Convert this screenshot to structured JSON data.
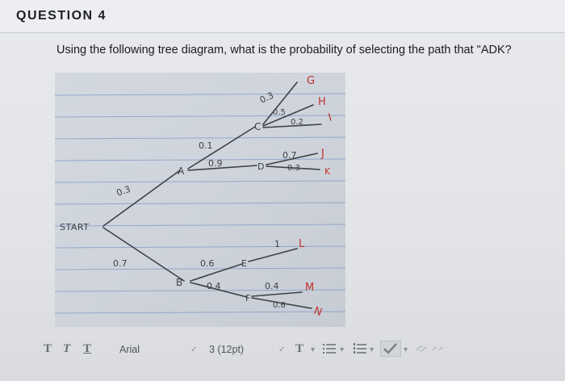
{
  "question": {
    "number": "QUESTION 4",
    "text": "Using the following tree diagram, what is the probability of selecting the path that \"ADK?"
  },
  "diagram": {
    "start": "START",
    "nodes": {
      "A": "A",
      "B": "B",
      "C": "C",
      "D": "D",
      "E": "E",
      "F": "F"
    },
    "leaves": {
      "G": "G",
      "H": "H",
      "I": "I",
      "J": "J",
      "K": "K",
      "L": "L",
      "M": "M",
      "N": "N"
    },
    "probabilities": {
      "start_A": "0.3",
      "start_B": "0.7",
      "A_C": "0.1",
      "A_D": "0.9",
      "B_E": "0.6",
      "B_F": "0.4",
      "C_G": "0.3",
      "C_H": "0.5",
      "C_I": "0.2",
      "D_J": "0.7",
      "D_K": "0.3",
      "E_L": "1",
      "F_M": "0.4",
      "F_N": "0.6"
    }
  },
  "toolbar": {
    "format_bold": "T",
    "format_italic": "T",
    "format_underline": "T",
    "font_family": "Arial",
    "font_size": "3 (12pt)",
    "text_color": "T"
  },
  "colors": {
    "ink": "#c0302c",
    "pencil": "#3d4145",
    "paper": "#cfd4dc",
    "rule_line": "#7f99c2"
  }
}
